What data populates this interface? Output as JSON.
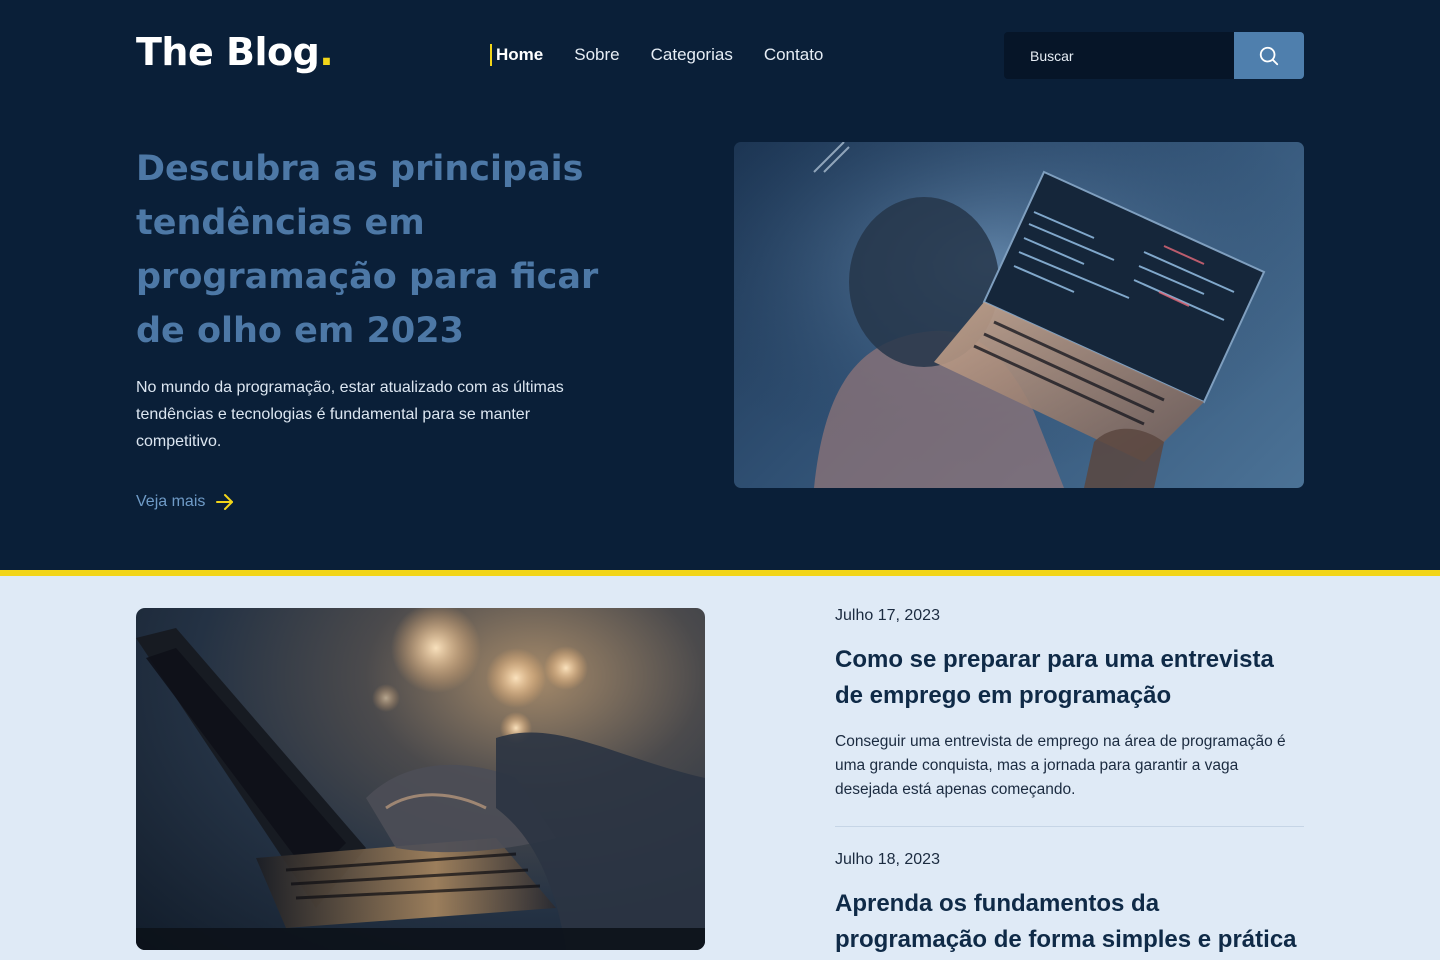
{
  "header": {
    "logo_text": "The Blog",
    "logo_dot": ".",
    "nav": [
      {
        "label": "Home",
        "active": true
      },
      {
        "label": "Sobre",
        "active": false
      },
      {
        "label": "Categorias",
        "active": false
      },
      {
        "label": "Contato",
        "active": false
      }
    ],
    "search": {
      "placeholder": "Buscar",
      "icon": "search-icon"
    }
  },
  "hero": {
    "title": "Descubra as principais tendências em programação para ficar de olho em 2023",
    "description": "No mundo da programação, estar atualizado com as últimas tendências e tecnologias é fundamental para se manter competitivo.",
    "more_label": "Veja mais",
    "more_icon": "arrow-right-icon",
    "image": "person-coding-laptop-photo"
  },
  "posts": [
    {
      "date": "Julho 17, 2023",
      "title": "Como se preparar para uma entrevista de emprego em programação",
      "excerpt": "Conseguir uma entrevista de emprego na área de programação é uma grande conquista, mas a jornada para garantir a vaga desejada está apenas começando."
    },
    {
      "date": "Julho 18, 2023",
      "title": "Aprenda os fundamentos da programação de forma simples e prática",
      "excerpt": ""
    }
  ],
  "colors": {
    "navy": "#0a1f38",
    "accent_yellow": "#f2d519",
    "blue": "#4d78a6",
    "light_bg": "#dfeaf6"
  }
}
